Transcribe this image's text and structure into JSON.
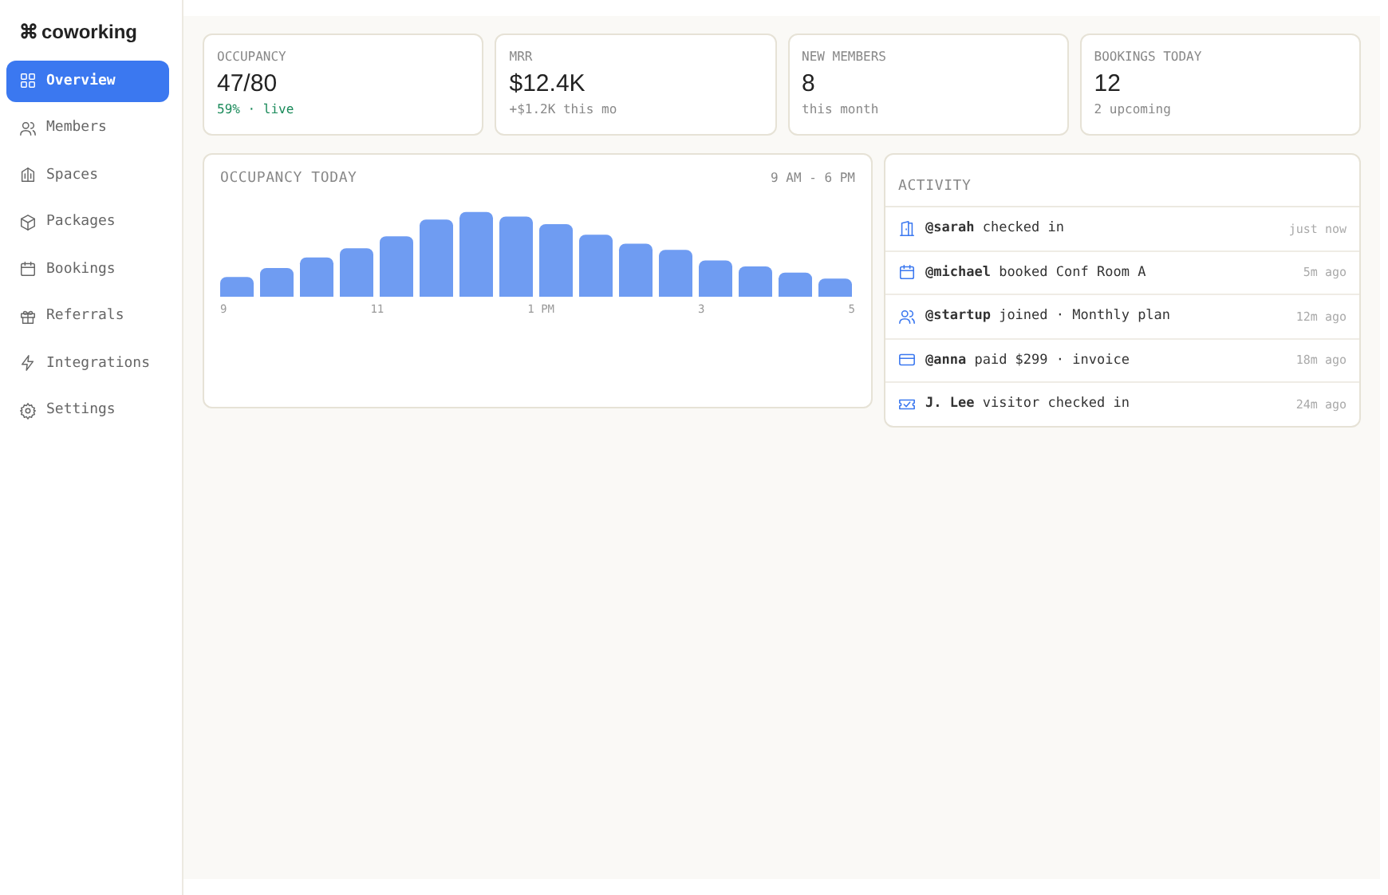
{
  "brand": {
    "symbol": "⌘",
    "name": "coworking"
  },
  "nav": [
    {
      "label": "Overview",
      "selected": true
    },
    {
      "label": "Members",
      "selected": false
    },
    {
      "label": "Spaces",
      "selected": false
    },
    {
      "label": "Packages",
      "selected": false
    },
    {
      "label": "Bookings",
      "selected": false
    },
    {
      "label": "Referrals",
      "selected": false
    },
    {
      "label": "Integrations",
      "selected": false
    },
    {
      "label": "Settings",
      "selected": false
    }
  ],
  "stats": [
    {
      "label": "OCCUPANCY",
      "value": "47/80",
      "note": "59% · live",
      "positive": true
    },
    {
      "label": "MRR",
      "value": "$12.4K",
      "note": "+$1.2K this mo",
      "positive": false
    },
    {
      "label": "NEW MEMBERS",
      "value": "8",
      "note": "this month",
      "positive": false
    },
    {
      "label": "BOOKINGS TODAY",
      "value": "12",
      "note": "2 upcoming",
      "positive": false
    }
  ],
  "occupancy": {
    "title": "OCCUPANCY TODAY",
    "range": "9 AM - 6 PM",
    "axis_labels": [
      "9",
      "11",
      "1 PM",
      "3",
      "5"
    ]
  },
  "activity": {
    "title": "ACTIVITY",
    "items": [
      {
        "text": "**@sarah** checked in",
        "time": "just now"
      },
      {
        "text": "**@michael** booked Conf Room A",
        "time": "5m ago"
      },
      {
        "text": "**@startup** joined · Monthly plan",
        "time": "12m ago"
      },
      {
        "text": "**@anna** paid $299 · invoice",
        "time": "18m ago"
      },
      {
        "text": "**J. Lee** visitor checked in",
        "time": "24m ago"
      }
    ]
  }
}
